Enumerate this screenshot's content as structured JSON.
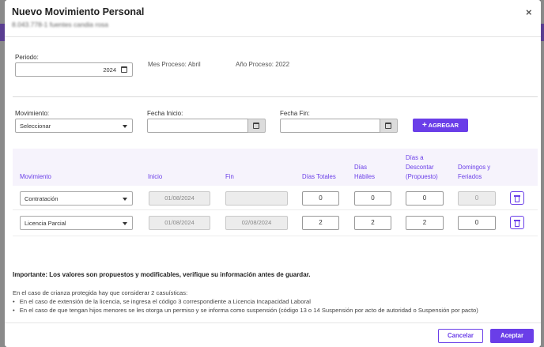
{
  "modal": {
    "title": "Nuevo Movimiento Personal",
    "subtitle": "8.043.778-1 fuentes candia rosa",
    "close_label": "×"
  },
  "periodo": {
    "label": "Periodo:",
    "value": "2024",
    "mes_proceso": "Mes Proceso: Abril",
    "anio_proceso": "Año Proceso: 2022"
  },
  "form": {
    "movimiento_label": "Movimiento:",
    "movimiento_value": "Seleccionar",
    "fecha_inicio_label": "Fecha Inicio:",
    "fecha_inicio_value": "",
    "fecha_fin_label": "Fecha Fin:",
    "fecha_fin_value": "",
    "add_button": "AGREGAR",
    "add_icon": "+"
  },
  "table": {
    "headers": {
      "movimiento": "Movimiento",
      "inicio": "Inicio",
      "fin": "Fin",
      "dias_totales": "Días Totales",
      "dias_habiles_1": "Días",
      "dias_habiles_2": "Hábiles",
      "dias_descontar_1": "Días a",
      "dias_descontar_2": "Descontar",
      "dias_descontar_3": "(Propuesto)",
      "domingos_1": "Domingos y",
      "domingos_2": "Feriados"
    },
    "rows": [
      {
        "movimiento": "Contratación",
        "inicio": "01/08/2024",
        "fin": "",
        "dias_totales": "0",
        "dias_habiles": "0",
        "dias_descontar": "0",
        "domingos": "0"
      },
      {
        "movimiento": "Licencia Parcial",
        "inicio": "01/08/2024",
        "fin": "02/08/2024",
        "dias_totales": "2",
        "dias_habiles": "2",
        "dias_descontar": "2",
        "domingos": "0"
      }
    ]
  },
  "notice": {
    "title": "Importante: Los valores son propuestos y modificables, verifique su información antes de guardar.",
    "intro": "En el caso de crianza protegida hay que considerar 2 casuísticas:",
    "bullet_1": "En el caso de extensión de la licencia, se ingresa el código 3 correspondiente a Licencia Incapacidad Laboral",
    "bullet_2": "En el caso de que tengan hijos menores se les otorga un permiso y se informa como suspensión (código 13 o 14 Suspensión por acto de autoridad o Suspensión por pacto)",
    "bullet_char": "•"
  },
  "footer": {
    "cancel": "Cancelar",
    "accept": "Aceptar"
  },
  "colors": {
    "accent": "#6a3ee8",
    "header_bg": "#f6f3fc"
  }
}
